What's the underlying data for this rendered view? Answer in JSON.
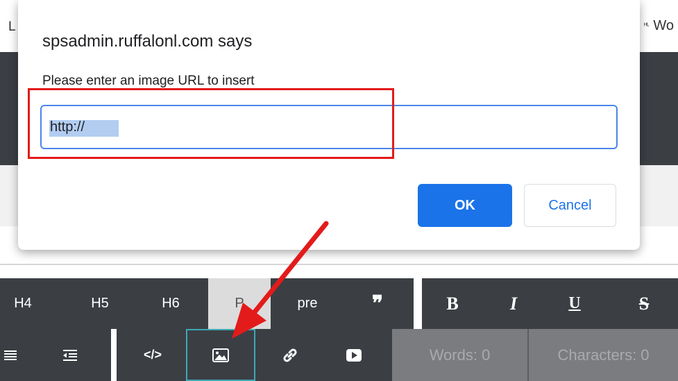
{
  "background": {
    "left_fragment": "L",
    "right_fragment": "Wo",
    "right_icon": "ᴴᴸ"
  },
  "dialog": {
    "title": "spsadmin.ruffalonl.com says",
    "message": "Please enter an image URL to insert",
    "input_value": "http://",
    "ok_label": "OK",
    "cancel_label": "Cancel"
  },
  "toolbar": {
    "row1": {
      "h4": "H4",
      "h5": "H5",
      "h6": "H6",
      "p": "P",
      "pre": "pre",
      "quote": "❞",
      "bold": "B",
      "italic": "I",
      "underline": "U",
      "strike": "S"
    },
    "row2": {
      "list_icon": "align-justify-icon",
      "outdent_icon": "outdent-icon",
      "code_label": "</>",
      "image_icon": "image-icon",
      "link_icon": "link-icon",
      "video_icon": "youtube-icon",
      "words": "Words: 0",
      "characters": "Characters: 0"
    }
  },
  "colors": {
    "toolbar_bg": "#3b3f44",
    "primary_blue": "#1a73e8",
    "annotation_red": "#e31b1b",
    "highlight_teal": "#3fa9b5"
  }
}
